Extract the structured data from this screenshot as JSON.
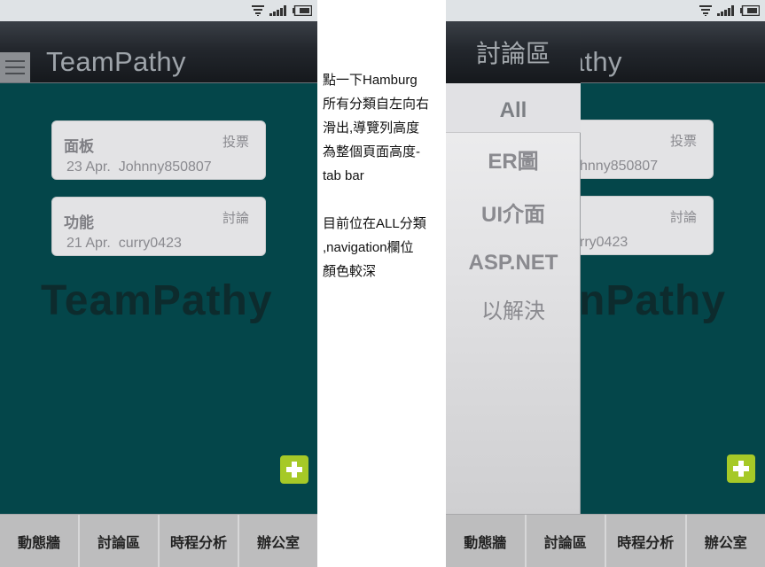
{
  "app": {
    "title": "TeamPathy",
    "watermark": "TeamPathy"
  },
  "cards": [
    {
      "title": "面板",
      "tag": "投票",
      "date": "23 Apr.",
      "author": "Johnny850807"
    },
    {
      "title": "功能",
      "tag": "討論",
      "date": "21 Apr.",
      "author": "curry0423"
    }
  ],
  "tabs": [
    "動態牆",
    "討論區",
    "時程分析",
    "辦公室"
  ],
  "note": {
    "paragraph1": [
      "點一下Hamburg",
      "所有分類自左向右",
      "滑出,導覽列高度",
      "為整個頁面高度-",
      "tab bar"
    ],
    "paragraph2": [
      "目前位在ALL分類",
      ",navigation欄位",
      "顏色較深"
    ]
  },
  "drawer": {
    "header": "討論區",
    "items": [
      "All",
      "ER圖",
      "UI介面",
      "ASP.NET",
      "以解決"
    ],
    "active_index": 0
  },
  "right_visible": {
    "title_fragment": "Pathy",
    "watermark_fragment": "nPathy",
    "card1_meta": "hnny850807",
    "card2_meta": "rry0423"
  },
  "icons": [
    "wifi-icon",
    "signal-icon",
    "battery-icon",
    "hamburger-menu-icon",
    "add-icon"
  ],
  "colors": {
    "background": "#04464a",
    "fab": "#a6c927",
    "tabbar": "#bdbdbe",
    "statusbar": "#dfe3e6"
  }
}
